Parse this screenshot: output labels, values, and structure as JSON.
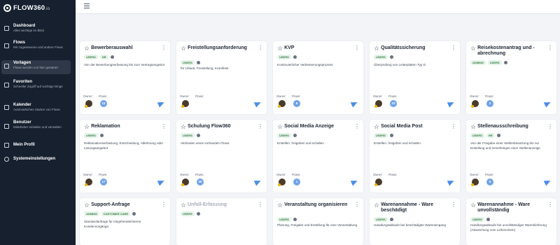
{
  "app": {
    "logo": "FLOW360",
    "logo_suffix": ".io"
  },
  "sidebar": {
    "items": [
      {
        "label": "Dashboard",
        "sub": "Alles wichtige im Blick",
        "icon": "bar-chart-icon"
      },
      {
        "label": "Flows",
        "sub": "Mir zugewiesene und andere Flows",
        "icon": "flows-icon"
      },
      {
        "label": "Vorlagen",
        "sub": "Flows werden von hier gestartet",
        "icon": "template-icon",
        "active": true
      },
      {
        "label": "Favoriten",
        "sub": "Schneller Zugriff auf wichtige Dinge",
        "icon": "star-icon"
      },
      {
        "label": "Kalender",
        "sub": "Automatisches Starten von Flows",
        "icon": "calendar-icon"
      },
      {
        "label": "Benutzer",
        "sub": "Mitarbeiter einladen und verwalten",
        "icon": "users-icon"
      },
      {
        "label": "Mein Profil",
        "sub": "",
        "icon": "profile-icon"
      },
      {
        "label": "Systemeinstellungen",
        "sub": "",
        "icon": "settings-icon"
      }
    ]
  },
  "card_meta": {
    "owner_label": "Owner:",
    "flows_label": "Flows:"
  },
  "cards": [
    {
      "title": "Bewerberauswahl",
      "badges": [
        "USERS",
        "HR"
      ],
      "desc": "Von der Bewerbungserfassung bis zum Vertragsangebot",
      "flows": "14"
    },
    {
      "title": "Freistellungsanforderung",
      "badges": [
        "USERS"
      ],
      "desc": "für Urlaub, Freistellung, Krankheit",
      "flows": ""
    },
    {
      "title": "KVP",
      "badges": [
        "USERS"
      ],
      "desc": "Kontinuierlicher Verbesserungsprozess",
      "flows": "6"
    },
    {
      "title": "Qualitätssicherung",
      "badges": [
        "USERS"
      ],
      "desc": "Überprüfung von Leiterplatten Typ D",
      "flows": "23"
    },
    {
      "title": "Reisekostenantrag und -abrechnung",
      "badges": [
        "ADMINS",
        "USERS"
      ],
      "desc": "",
      "flows": "2"
    },
    {
      "title": "Reklamation",
      "badges": [
        "USERS"
      ],
      "desc": "Reklamationserfassung, Entscheidung, Ablehnung oder Lösungsangebot",
      "flows": "17"
    },
    {
      "title": "Schulung Flow360",
      "badges": [
        "USERS"
      ],
      "desc": "Verbinden eines vorhanden Flows.",
      "flows": "30"
    },
    {
      "title": "Social Media Anzeige",
      "badges": [
        "USERS"
      ],
      "desc": "Erstellen, freigeben und schalten",
      "flows": "1"
    },
    {
      "title": "Social Media Post",
      "badges": [
        "USERS"
      ],
      "desc": "Erstellen, freigeben und schalten",
      "flows": ""
    },
    {
      "title": "Stellenausschreibung",
      "badges": [
        "USERS",
        "HR"
      ],
      "desc": "Von der Freigabe einer Stellenbesetzung bis zur Erstellung und Genehmigen einer Stellenanzeige",
      "flows": "8"
    },
    {
      "title": "Support-Anfrage",
      "badges": [
        "ADMINS",
        "CUSTOMER CARE"
      ],
      "desc": "Standardanfrage für eingehende/interne Kundenvorgänge",
      "flows": ""
    },
    {
      "title": "Unfall-Erfassung",
      "badges": [
        "USERS"
      ],
      "desc": "",
      "flows": "",
      "disabled": true
    },
    {
      "title": "Veranstaltung organisieren",
      "badges": [
        "USERS"
      ],
      "desc": "Planung, Freigabe und Erstellung für eine Veranstaltung",
      "flows": ""
    },
    {
      "title": "Warenannahme - Ware beschädigt",
      "badges": [
        "USERS"
      ],
      "desc": "Handlungsablaufe bei beschädigter Wareneingang",
      "flows": ""
    },
    {
      "title": "Warenannahme - Ware unvollständig",
      "badges": [
        "USERS"
      ],
      "desc": "Handlungsablaufe bei unvollständiger Warenlieferung (Abweichung vom Lieferschein)",
      "flows": ""
    }
  ]
}
